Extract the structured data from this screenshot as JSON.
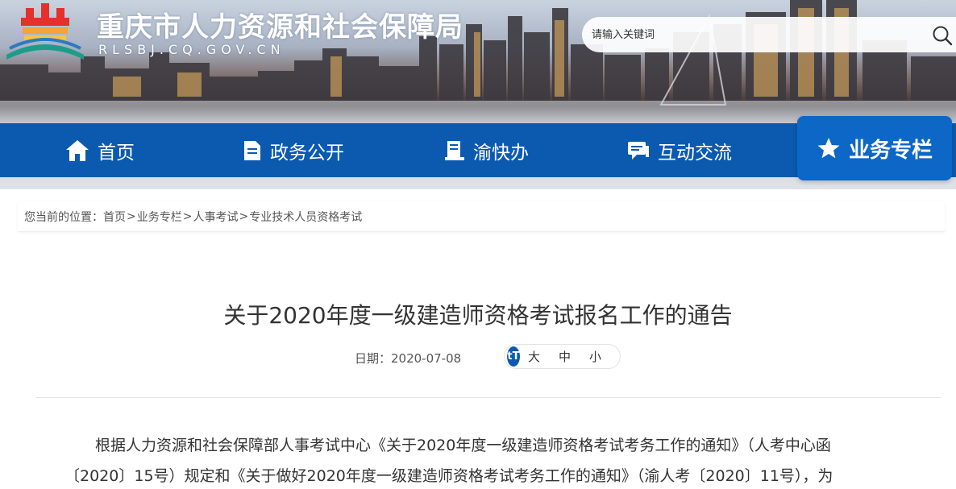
{
  "header": {
    "site_title": "重庆市人力资源和社会保障局",
    "site_domain": "RLSBJ.CQ.GOV.CN",
    "search_placeholder": "请输入关键词"
  },
  "nav": {
    "items": [
      {
        "label": "首页",
        "icon": "home-icon"
      },
      {
        "label": "政务公开",
        "icon": "document-icon"
      },
      {
        "label": "渝快办",
        "icon": "service-icon"
      },
      {
        "label": "互动交流",
        "icon": "chat-icon"
      }
    ],
    "active": {
      "label": "业务专栏",
      "icon": "star-icon"
    }
  },
  "breadcrumb": {
    "prefix": "您当前的位置：",
    "items": [
      "首页",
      "业务专栏",
      "人事考试",
      "专业技术人员资格考试"
    ],
    "separator": ">"
  },
  "article": {
    "title": "关于2020年度一级建造师资格考试报名工作的通告",
    "date_label": "日期：2020-07-08",
    "font_sizes": [
      "大",
      "中",
      "小"
    ],
    "font_icon_text": "tT",
    "paragraph_lines": [
      "根据人力资源和社会保障部人事考试中心《关于2020年度一级建造师资格考试考务工作的通知》（人考中心函",
      "〔2020〕15号）规定和《关于做好2020年度一级建造师资格考试考务工作的通知》（渝人考〔2020〕11号），为"
    ]
  },
  "colors": {
    "nav_blue": "#0b5ab0",
    "nav_active": "#0d67c6",
    "text": "#333333"
  }
}
